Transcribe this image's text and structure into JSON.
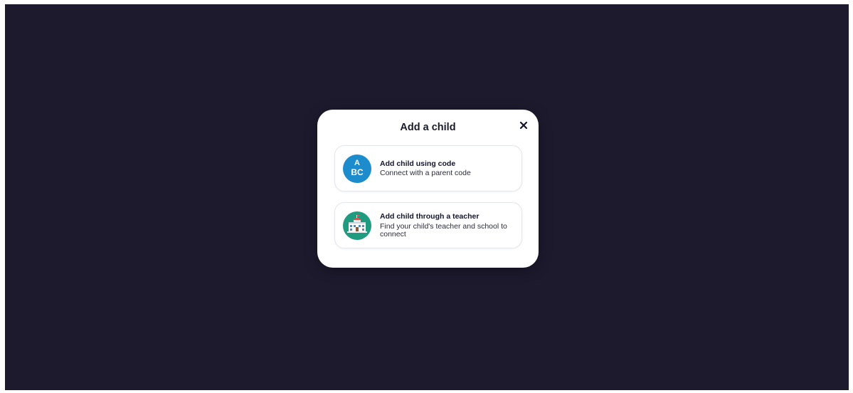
{
  "modal": {
    "title": "Add a child",
    "close_label": "×",
    "options": [
      {
        "icon": "abc-icon",
        "icon_text_top": "A",
        "icon_text_bottom": "BC",
        "title": "Add child using code",
        "subtitle": "Connect with a parent code"
      },
      {
        "icon": "school-building-icon",
        "title": "Add child through a teacher",
        "subtitle": "Find your child's teacher and school to connect"
      }
    ]
  },
  "colors": {
    "overlay": "#1d1a2e",
    "code_icon_bg": "#1d8ccd",
    "teacher_icon_bg": "#1f9b80"
  }
}
